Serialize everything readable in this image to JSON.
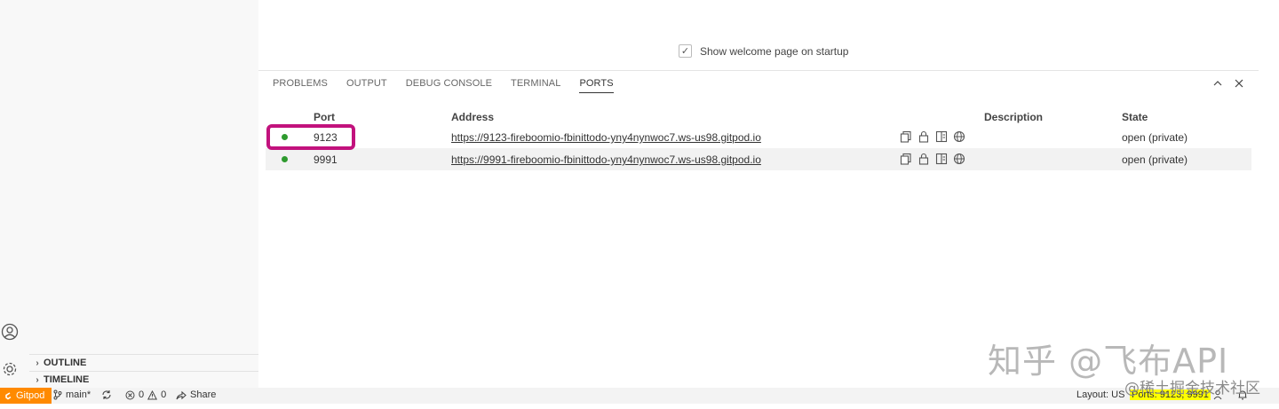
{
  "welcome": {
    "checkbox_checked": true,
    "label": "Show welcome page on startup"
  },
  "sidebar": {
    "sections": [
      {
        "label": "OUTLINE"
      },
      {
        "label": "TIMELINE"
      }
    ]
  },
  "panel": {
    "tabs": [
      {
        "label": "PROBLEMS",
        "active": false
      },
      {
        "label": "OUTPUT",
        "active": false
      },
      {
        "label": "DEBUG CONSOLE",
        "active": false
      },
      {
        "label": "TERMINAL",
        "active": false
      },
      {
        "label": "PORTS",
        "active": true
      }
    ],
    "actions": [
      "maximize-panel",
      "close-panel"
    ]
  },
  "ports": {
    "columns": {
      "port": "Port",
      "address": "Address",
      "description": "Description",
      "state": "State"
    },
    "rows": [
      {
        "port": "9123",
        "address": "https://9123-fireboomio-fbinittodo-yny4nynwoc7.ws-us98.gitpod.io",
        "description": "",
        "state": "open (private)",
        "status_color": "#2e9a2e",
        "highlighted": true
      },
      {
        "port": "9991",
        "address": "https://9991-fireboomio-fbinittodo-yny4nynwoc7.ws-us98.gitpod.io",
        "description": "",
        "state": "open (private)",
        "status_color": "#2e9a2e",
        "highlighted": false
      }
    ],
    "row_icons": [
      "copy-icon",
      "lock-icon",
      "preview-icon",
      "globe-icon"
    ]
  },
  "statusbar": {
    "gitpod": "Gitpod",
    "branch": "main*",
    "errors": "0",
    "warnings": "0",
    "share": "Share",
    "layout": "Layout: US",
    "ports": "Ports: 9123, 9991"
  },
  "watermark": {
    "line1": "知乎 @飞布API",
    "line2": "@稀土掘金技术社区"
  },
  "colors": {
    "gitpod_orange": "#ff8a00",
    "highlight_magenta": "#c2127d",
    "ports_badge_yellow": "#ffff00",
    "status_green": "#2e9a2e"
  }
}
